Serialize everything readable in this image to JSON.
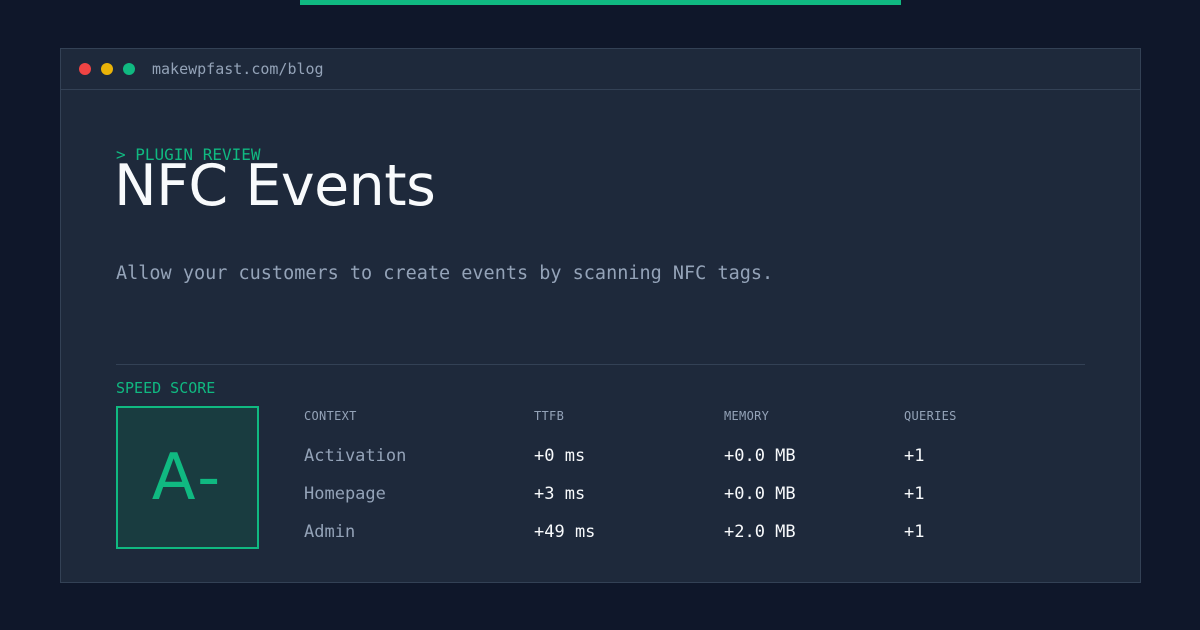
{
  "accent_color": "#10b981",
  "window": {
    "url": "makewpfast.com/blog"
  },
  "post": {
    "kicker": "> PLUGIN REVIEW",
    "title": "NFC Events",
    "description": "Allow your customers to create events by scanning NFC tags."
  },
  "score": {
    "label": "SPEED SCORE",
    "grade": "A-"
  },
  "metrics": {
    "headers": [
      "CONTEXT",
      "TTFB",
      "MEMORY",
      "QUERIES"
    ],
    "rows": [
      [
        "Activation",
        "+0 ms",
        "+0.0 MB",
        "+1"
      ],
      [
        "Homepage",
        "+3 ms",
        "+0.0 MB",
        "+1"
      ],
      [
        "Admin",
        "+49 ms",
        "+2.0 MB",
        "+1"
      ]
    ]
  }
}
